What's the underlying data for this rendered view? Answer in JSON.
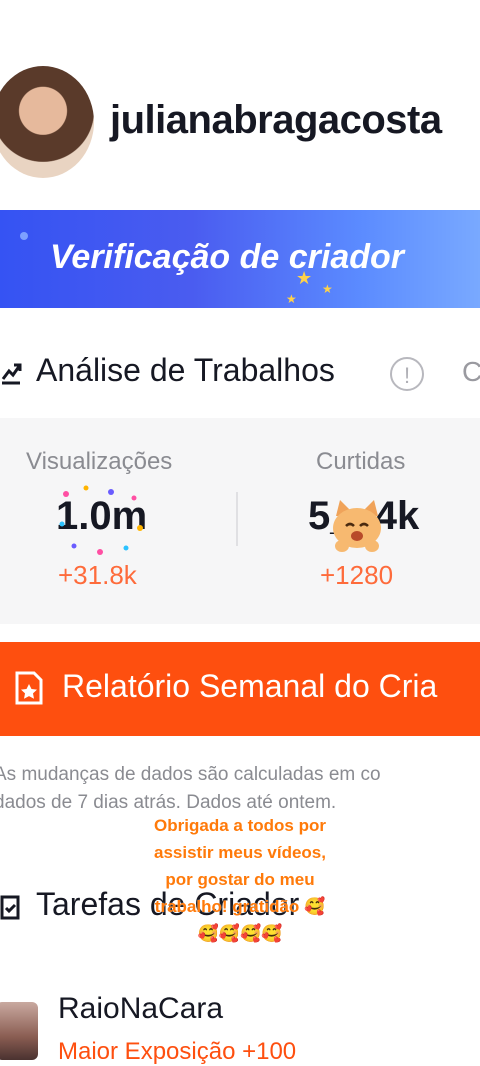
{
  "profile": {
    "username": "julianabragacosta"
  },
  "banner": {
    "title": "Verificação de criador"
  },
  "analysis": {
    "title": "Análise de Trabalhos",
    "info_glyph": "!",
    "truncated_next": "C",
    "stats": [
      {
        "label": "Visualizações",
        "value": "1.0m",
        "delta": "+31.8k"
      },
      {
        "label": "Curtidas",
        "value": "5__4k",
        "delta": "+1280"
      }
    ]
  },
  "report": {
    "label": "Relatório Semanal do Cria"
  },
  "notes": {
    "line1": "As mudanças de dados são calculadas em co",
    "line2": "dados de 7 dias atrás. Dados até ontem."
  },
  "caption": {
    "line1": "Obrigada a todos por",
    "line2": "assistir meus vídeos,",
    "line3": "por gostar do meu",
    "line4": "trabalho! gratidão 🥰",
    "line5": "🥰🥰🥰🥰"
  },
  "tasks": {
    "title": "Tarefas de Criador",
    "items": [
      {
        "name": "RaioNaCara",
        "reward": "Maior Exposição +100"
      }
    ]
  },
  "colors": {
    "accent": "#fe4f0f",
    "banner_blue": "#3553f3",
    "delta": "#fe6b3b"
  }
}
